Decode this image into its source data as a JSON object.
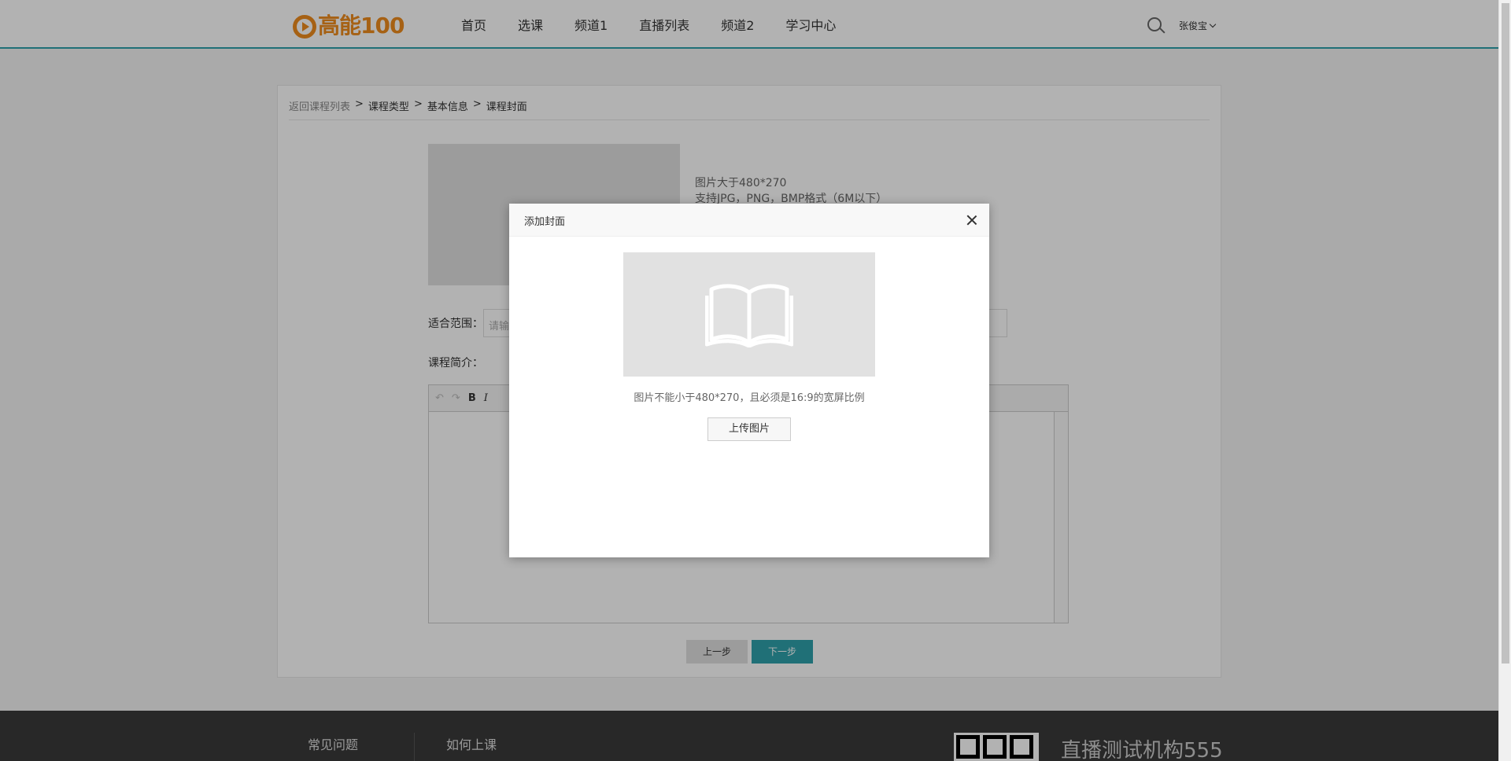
{
  "header": {
    "logo_text": "高能100",
    "nav": [
      "首页",
      "选课",
      "频道1",
      "直播列表",
      "频道2",
      "学习中心"
    ],
    "user_name": "张俊宝"
  },
  "breadcrumb": {
    "back": "返回课程列表",
    "sep": ">",
    "steps": [
      "课程类型",
      "基本信息",
      "课程封面"
    ]
  },
  "cover": {
    "hint_line1": "图片大于480*270",
    "hint_line2": "支持JPG，PNG，BMP格式（6M以下）"
  },
  "form": {
    "scope_label": "适合范围：",
    "scope_placeholder": "请输入",
    "intro_label": "课程简介："
  },
  "editor": {
    "toolbar": [
      "↶",
      "↷",
      "B",
      "I"
    ]
  },
  "buttons": {
    "prev": "上一步",
    "next": "下一步"
  },
  "modal": {
    "title": "添加封面",
    "hint": "图片不能小于480*270，且必须是16:9的宽屏比例",
    "upload_label": "上传图片"
  },
  "footer": {
    "links": [
      "常见问题",
      "如何上课"
    ],
    "org_name": "直播测试机构555"
  },
  "colors": {
    "accent": "#2fa1ab",
    "brand": "#ee8c1d"
  }
}
